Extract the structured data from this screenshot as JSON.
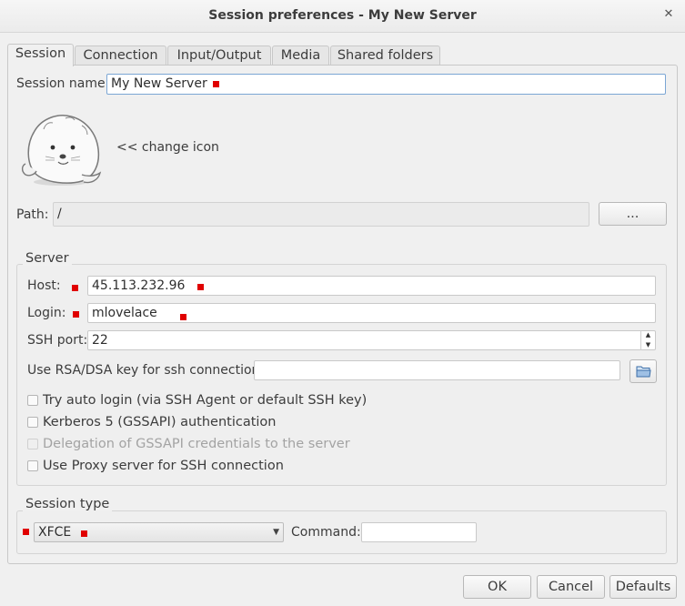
{
  "window": {
    "title": "Session preferences - My New Server"
  },
  "tabs": [
    {
      "label": "Session",
      "active": true
    },
    {
      "label": "Connection",
      "active": false
    },
    {
      "label": "Input/Output",
      "active": false
    },
    {
      "label": "Media",
      "active": false
    },
    {
      "label": "Shared folders",
      "active": false
    }
  ],
  "session": {
    "name_label": "Session name:",
    "name_value": "My New Server",
    "change_icon_label": "<< change icon",
    "path_label": "Path:",
    "path_value": "/",
    "browse_label": "..."
  },
  "server": {
    "group_title": "Server",
    "host_label": "Host:",
    "host_value": "45.113.232.96",
    "login_label": "Login:",
    "login_value": "mlovelace",
    "ssh_port_label": "SSH port:",
    "ssh_port_value": "22",
    "rsa_label": "Use RSA/DSA key for ssh connection:",
    "rsa_value": "",
    "checkboxes": [
      {
        "label": "Try auto login (via SSH Agent or default SSH key)",
        "checked": false,
        "enabled": true
      },
      {
        "label": "Kerberos 5 (GSSAPI) authentication",
        "checked": false,
        "enabled": true
      },
      {
        "label": "Delegation of GSSAPI credentials to the server",
        "checked": false,
        "enabled": false
      },
      {
        "label": "Use Proxy server for SSH connection",
        "checked": false,
        "enabled": true
      }
    ]
  },
  "session_type": {
    "group_title": "Session type",
    "selected": "XFCE",
    "command_label": "Command:",
    "command_value": ""
  },
  "buttons": {
    "ok": "OK",
    "cancel": "Cancel",
    "defaults": "Defaults"
  },
  "colors": {
    "marker": "#e00000",
    "focus_border": "#7ba6d4"
  }
}
